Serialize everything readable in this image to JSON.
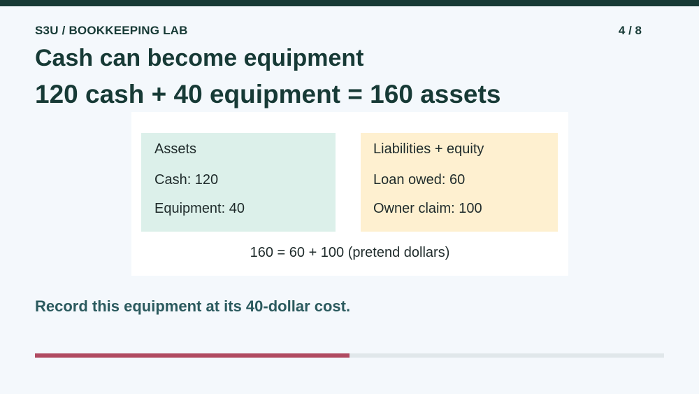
{
  "header": {
    "course_label": "S3U / BOOKKEEPING LAB",
    "page_counter": "4 / 8"
  },
  "slide": {
    "title": "Cash can become equipment",
    "equation": "120 cash + 40 equipment = 160 assets"
  },
  "balance_card": {
    "assets": {
      "heading": "Assets",
      "lines": [
        "Cash: 120",
        "Equipment: 40"
      ]
    },
    "liabilities_equity": {
      "heading": "Liabilities + equity",
      "lines": [
        "Loan owed: 60",
        "Owner claim: 100"
      ]
    },
    "footer": "160 = 60 + 100 (pretend dollars)"
  },
  "note": "Record this equipment at its 40-dollar cost.",
  "progress": {
    "current_page": 4,
    "total_pages": 8,
    "fraction": 0.5
  },
  "colors": {
    "top_bar": "#173a36",
    "assets_bg": "#dcf0ea",
    "liabilities_bg": "#fef0d0",
    "progress_fill": "#b04a61",
    "progress_track": "#e0e7ea"
  }
}
